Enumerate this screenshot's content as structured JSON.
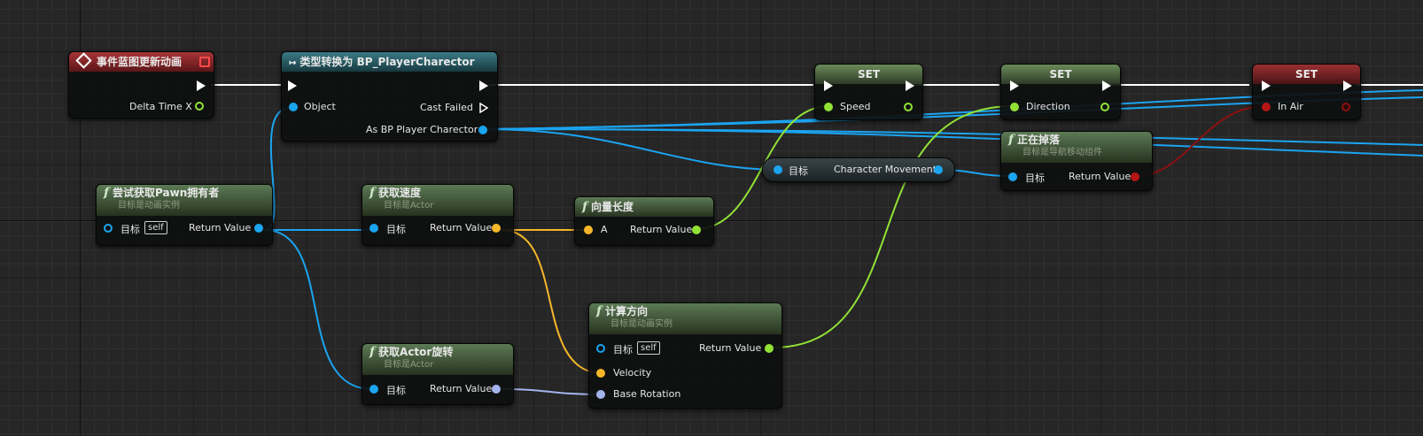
{
  "nodes": {
    "event": {
      "title": "事件蓝图更新动画",
      "out_pin": "Delta Time X"
    },
    "cast": {
      "title": "类型转换为 BP_PlayerCharector",
      "pin_object": "Object",
      "pin_failed": "Cast Failed",
      "pin_as": "As BP Player Charector"
    },
    "try_pawn": {
      "title": "尝试获取Pawn拥有者",
      "subtitle": "目标是动画实例",
      "pin_target": "目标",
      "self": "self",
      "pin_return": "Return Value"
    },
    "get_velocity": {
      "title": "获取速度",
      "subtitle": "目标是Actor",
      "pin_target": "目标",
      "pin_return": "Return Value"
    },
    "vector_length": {
      "title": "向量长度",
      "pin_a": "A",
      "pin_return": "Return Value"
    },
    "calc_direction": {
      "title": "计算方向",
      "subtitle": "目标是动画实例",
      "pin_target": "目标",
      "self": "self",
      "pin_return": "Return Value",
      "pin_velocity": "Velocity",
      "pin_rotation": "Base Rotation"
    },
    "get_rotation": {
      "title": "获取Actor旋转",
      "subtitle": "目标是Actor",
      "pin_target": "目标",
      "pin_return": "Return Value"
    },
    "set_speed": {
      "title": "SET",
      "pin": "Speed"
    },
    "set_direction": {
      "title": "SET",
      "pin": "Direction"
    },
    "set_inair": {
      "title": "SET",
      "pin": "In Air"
    },
    "falling": {
      "title": "正在掉落",
      "subtitle": "目标是导航移动组件",
      "pin_target": "目标",
      "pin_return": "Return Value"
    },
    "char_movement": {
      "pin_target": "目标",
      "label": "Character Movement"
    }
  },
  "colors": {
    "exec": "#ffffff",
    "object": "#1ba4f0",
    "float": "#92e236",
    "vector": "#f5b72a",
    "rotator": "#a3b3ee",
    "bool": "#b51616"
  },
  "icons": {
    "event": "diamond-icon",
    "cast": "cast-arrow-icon",
    "function": "function-icon"
  }
}
